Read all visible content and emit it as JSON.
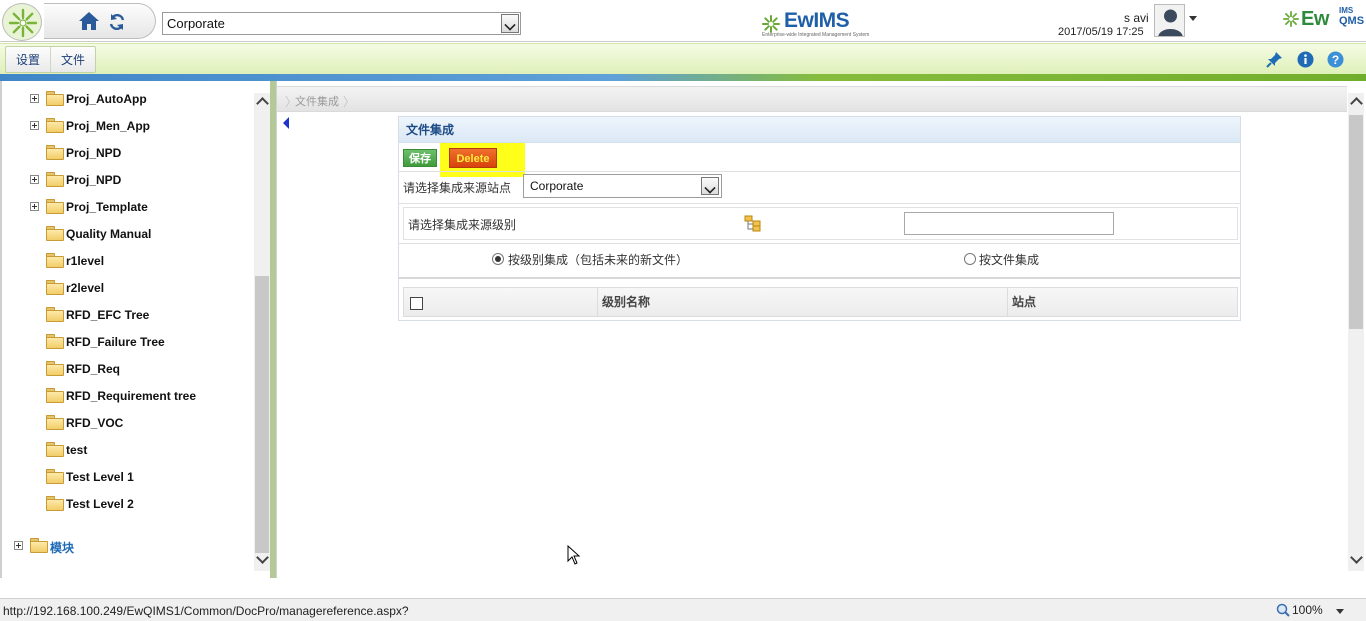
{
  "header": {
    "site_select_value": "Corporate",
    "brand_center": "EwIMS",
    "brand_center_tagline": "Enterprise-wide Integrated Management System",
    "user_name": "s avi",
    "datetime": "2017/05/19 17:25",
    "brand_right": "Ew",
    "brand_right_sup": "IMS",
    "brand_right_sub": "QMS"
  },
  "menubar": {
    "items": [
      {
        "label": "设置"
      },
      {
        "label": "文件"
      }
    ],
    "tools": [
      "pin-icon",
      "info-icon",
      "help-icon"
    ]
  },
  "tree": {
    "items": [
      {
        "label": "Proj_AutoApp",
        "expandable": true
      },
      {
        "label": "Proj_Men_App",
        "expandable": true
      },
      {
        "label": "Proj_NPD",
        "expandable": false
      },
      {
        "label": "Proj_NPD",
        "expandable": true
      },
      {
        "label": "Proj_Template",
        "expandable": true
      },
      {
        "label": "Quality Manual",
        "expandable": false
      },
      {
        "label": "r1level",
        "expandable": false
      },
      {
        "label": "r2level",
        "expandable": false
      },
      {
        "label": "RFD_EFC Tree",
        "expandable": false
      },
      {
        "label": "RFD_Failure Tree",
        "expandable": false
      },
      {
        "label": "RFD_Req",
        "expandable": false
      },
      {
        "label": "RFD_Requirement tree",
        "expandable": false
      },
      {
        "label": "RFD_VOC",
        "expandable": false
      },
      {
        "label": "test",
        "expandable": false
      },
      {
        "label": "Test Level 1",
        "expandable": false
      },
      {
        "label": "Test Level 2",
        "expandable": false
      }
    ],
    "module_label": "模块"
  },
  "main": {
    "breadcrumb": "文件集成",
    "panel_title": "文件集成",
    "save_label": "保存",
    "delete_label": "Delete",
    "source_site_label": "请选择集成来源站点",
    "source_site_value": "Corporate",
    "source_level_label": "请选择集成来源级别",
    "source_level_value": "",
    "radio_by_level": "按级别集成（包括未来的新文件）",
    "radio_by_file": "按文件集成",
    "radio_selected": "by_level",
    "grid_headers": [
      "级别名称",
      "站点"
    ]
  },
  "statusbar": {
    "url": "http://192.168.100.249/EwQIMS1/Common/DocPro/managereference.aspx?",
    "zoom": "100%"
  },
  "colors": {
    "accent_blue": "#1d4b86",
    "menubar_green": "#dff0b8",
    "highlight_yellow": "#ffff1a",
    "delete_orange": "#d8420d",
    "save_green": "#3f9b3c"
  }
}
